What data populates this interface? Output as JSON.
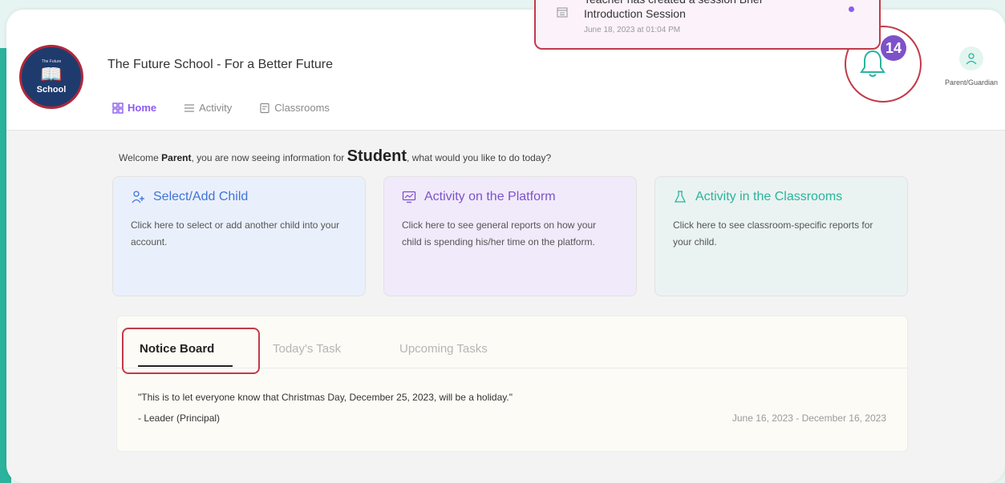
{
  "header": {
    "school_name": "The Future School - For a Better Future",
    "logo_text": "School",
    "logo_top": "The Future",
    "notifications_count": "14",
    "profile_label": "Parent/Guardian"
  },
  "nav": [
    {
      "label": "Home",
      "icon": "grid-icon",
      "active": true
    },
    {
      "label": "Activity",
      "icon": "list-icon",
      "active": false
    },
    {
      "label": "Classrooms",
      "icon": "clipboard-icon",
      "active": false
    }
  ],
  "notification": {
    "title_line1": "Teacher has created a session Brief",
    "title_line2": "Introduction Session",
    "date": "June 18, 2023 at 01:04 PM"
  },
  "welcome": {
    "prefix": "Welcome ",
    "role": "Parent",
    "middle": ", you are now seeing information for ",
    "student": "Student",
    "suffix": ", what would you like to do today?"
  },
  "cards": [
    {
      "title": "Select/Add Child",
      "desc": "Click here to select or add another child into your account.",
      "icon": "child-icon"
    },
    {
      "title": "Activity on the Platform",
      "desc": "Click here to see general reports on how your child is spending his/her time on the platform.",
      "icon": "monitor-icon"
    },
    {
      "title": "Activity in the Classrooms",
      "desc": "Click here to see classroom-specific reports for your child.",
      "icon": "flask-icon"
    }
  ],
  "board": {
    "tabs": [
      "Notice Board",
      "Today's Task",
      "Upcoming Tasks"
    ],
    "notice_text": "\"This is to let everyone know that Christmas Day, December 25, 2023, will be a holiday.\"",
    "notice_author": "- Leader (Principal)",
    "notice_date": "June 16, 2023 - December 16, 2023"
  },
  "colors": {
    "accent_purple": "#8c5cf0",
    "teal": "#2bb39d",
    "highlight_red": "#c23a4a",
    "blue": "#3f74d6"
  }
}
